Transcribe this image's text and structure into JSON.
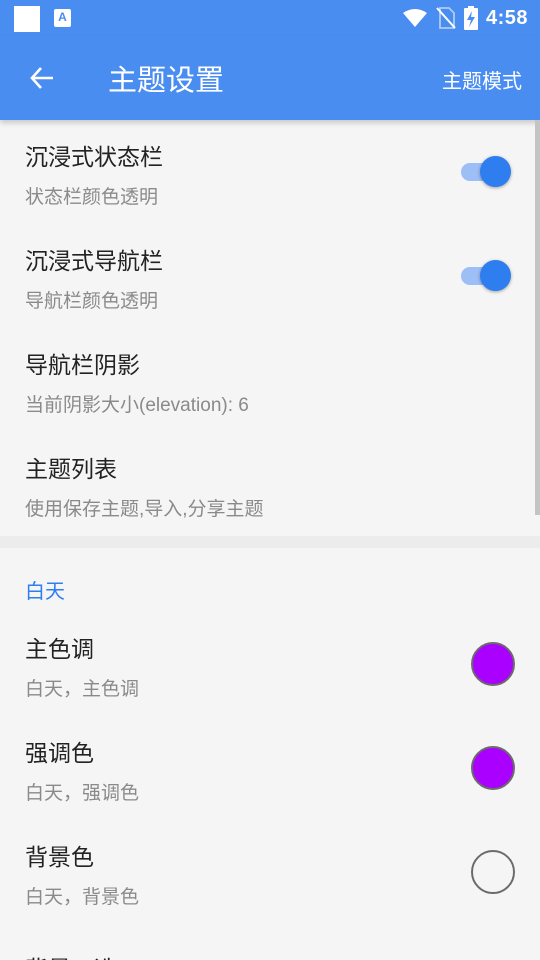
{
  "status_bar": {
    "time": "4:58",
    "notification_a": "A",
    "icons": [
      "square-notification-icon",
      "a-notification-icon",
      "wifi-icon",
      "no-sim-icon",
      "battery-charging-icon"
    ]
  },
  "app_bar": {
    "title": "主题设置",
    "mode_button": "主题模式",
    "back_icon": "arrow-left-icon",
    "color": "#4a8df0"
  },
  "settings": [
    {
      "title": "沉浸式状态栏",
      "subtitle": "状态栏颜色透明",
      "switch_on": true
    },
    {
      "title": "沉浸式导航栏",
      "subtitle": "导航栏颜色透明",
      "switch_on": true
    },
    {
      "title": "导航栏阴影",
      "subtitle": "当前阴影大小(elevation): 6"
    },
    {
      "title": "主题列表",
      "subtitle": "使用保存主题,导入,分享主题"
    }
  ],
  "day_section": {
    "header": "白天",
    "items": [
      {
        "title": "主色调",
        "subtitle": "白天，主色调",
        "color": "#aa00ff"
      },
      {
        "title": "强调色",
        "subtitle": "白天，强调色",
        "color": "#aa00ff"
      },
      {
        "title": "背景色",
        "subtitle": "白天，背景色",
        "color": "#f5f5f5"
      }
    ],
    "partial_item_title": "背景二选"
  },
  "accent_color": "#2f7ef0"
}
